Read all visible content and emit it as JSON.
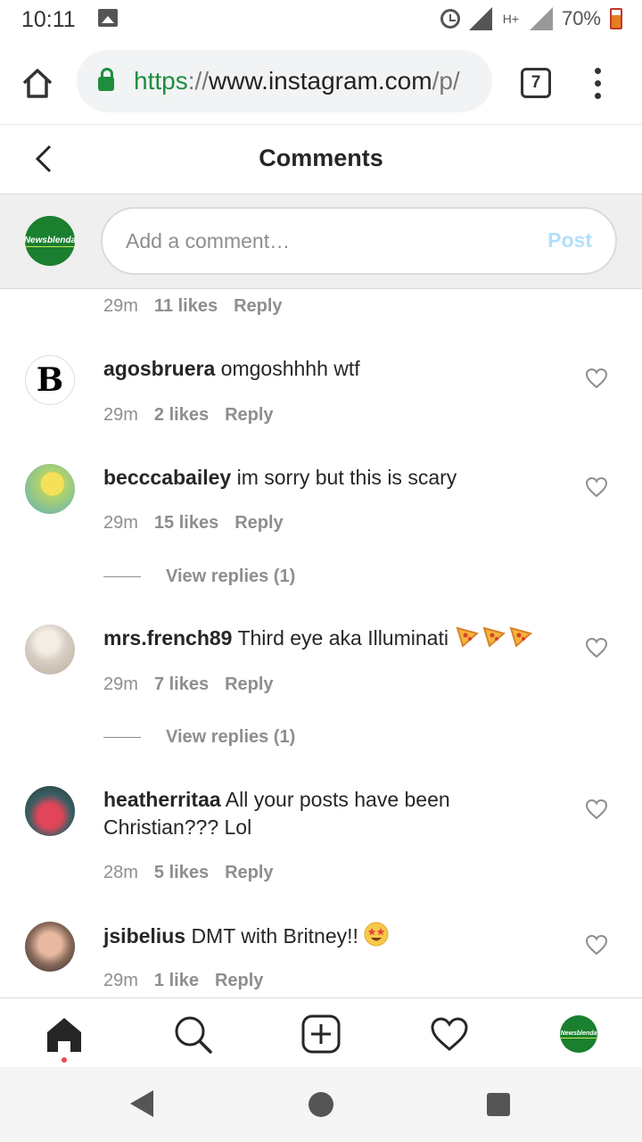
{
  "status_bar": {
    "time": "10:11",
    "network": "H+",
    "battery_percent": "70%"
  },
  "browser": {
    "url_scheme": "https",
    "url_separator": "://",
    "url_host": "www.instagram.com",
    "url_path": "/p/",
    "tab_count": "7"
  },
  "header": {
    "title": "Comments"
  },
  "compose": {
    "avatar_text": "Newsblenda",
    "placeholder": "Add a comment…",
    "post_label": "Post"
  },
  "comments": [
    {
      "time": "29m",
      "likes": "11 likes",
      "reply": "Reply"
    },
    {
      "user": "agosbruera",
      "text": "omgoshhhh wtf",
      "time": "29m",
      "likes": "2 likes",
      "reply": "Reply",
      "avatar_letter": "B"
    },
    {
      "user": "becccabailey",
      "text": "im sorry but this is scary",
      "time": "29m",
      "likes": "15 likes",
      "reply": "Reply",
      "view_replies": "View replies (1)"
    },
    {
      "user": "mrs.french89",
      "text": "Third eye aka Illuminati",
      "emoji": "pizza-emoji x3",
      "time": "29m",
      "likes": "7 likes",
      "reply": "Reply",
      "view_replies": "View replies (1)"
    },
    {
      "user": "heatherritaa",
      "text": "All your posts have been Christian??? Lol",
      "time": "28m",
      "likes": "5 likes",
      "reply": "Reply"
    },
    {
      "user": "jsibelius",
      "text": "DMT with Britney!!",
      "emoji": "star-struck-emoji",
      "time": "29m",
      "likes": "1 like",
      "reply": "Reply"
    }
  ],
  "bottom_nav": {
    "avatar_text": "Newsblenda",
    "icons": [
      "home-icon",
      "search-icon",
      "new-post-icon",
      "activity-heart-icon",
      "profile-avatar"
    ]
  },
  "colors": {
    "brand_green": "#1a7f2e",
    "secure_green": "#1e8e3e",
    "post_disabled": "#b2dffc",
    "meta_gray": "#8e8e8e",
    "notification_dot": "#ed4956"
  }
}
